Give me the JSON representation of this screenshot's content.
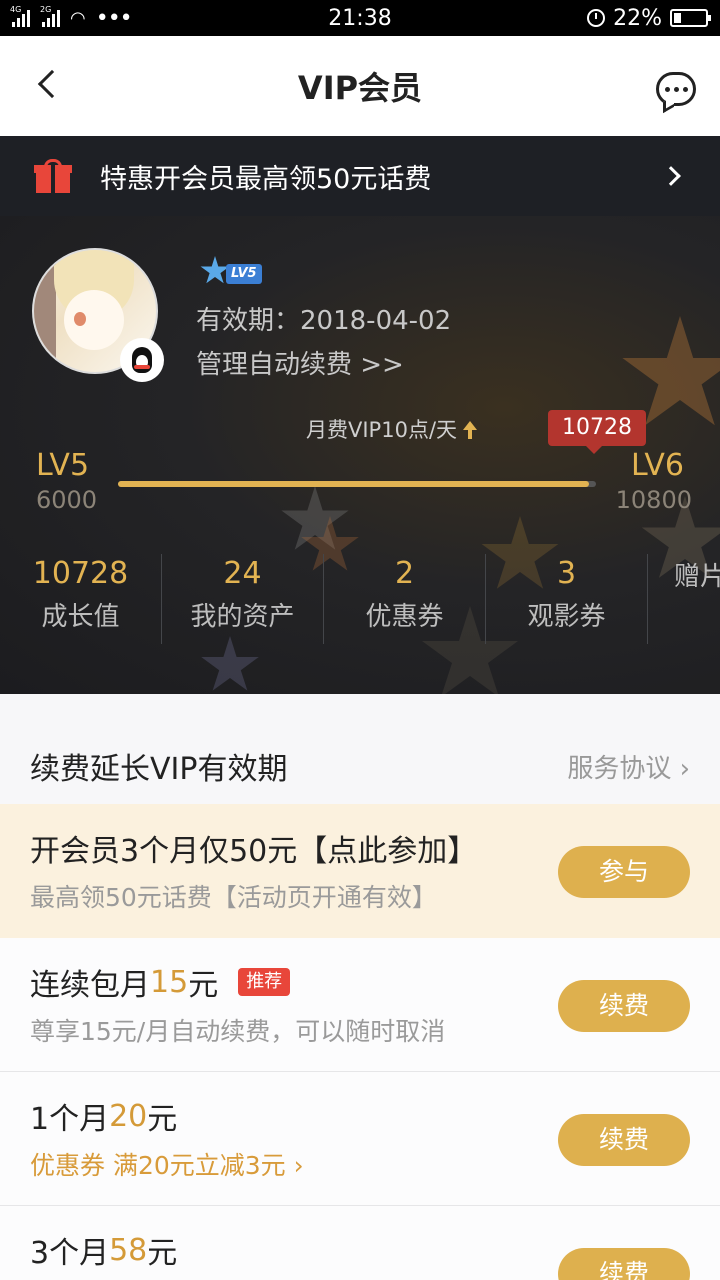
{
  "status_bar": {
    "net_1": "4G",
    "net_2": "2G",
    "time": "21:38",
    "battery": "22%"
  },
  "header": {
    "title": "VIP会员"
  },
  "promo": {
    "text": "特惠开会员最高领50元话费"
  },
  "profile": {
    "level_badge": "LV5",
    "valid_label": "有效期：",
    "valid_date": "2018-04-02",
    "manage_link": "管理自动续费 >>"
  },
  "growth": {
    "rate_text": "月费VIP10点/天",
    "current": "10728",
    "current_value": 10728,
    "level_from": "LV5",
    "level_from_points": "6000",
    "level_to": "LV6",
    "level_to_points": "10800"
  },
  "stats": [
    {
      "value": "10728",
      "label": "成长值"
    },
    {
      "value": "24",
      "label": "我的资产"
    },
    {
      "value": "2",
      "label": "优惠券"
    },
    {
      "value": "3",
      "label": "观影券"
    },
    {
      "value": "",
      "label": "赠片"
    }
  ],
  "renew": {
    "title": "续费延长VIP有效期",
    "service_link": "服务协议",
    "plans": [
      {
        "title": "开会员3个月仅50元【点此参加】",
        "subtitle": "最高领50元话费【活动页开通有效】",
        "button": "参与"
      },
      {
        "title_prefix": "连续包月",
        "price": "15",
        "unit": "元",
        "tag": "推荐",
        "subtitle": "尊享15元/月自动续费，可以随时取消",
        "button": "续费"
      },
      {
        "title_prefix": "1个月",
        "price": "20",
        "unit": "元",
        "subtitle": "优惠券 满20元立减3元",
        "button": "续费"
      },
      {
        "title_prefix": "3个月",
        "price": "58",
        "unit": "元",
        "button": "续费"
      }
    ]
  },
  "colors": {
    "gold": "#e2b352",
    "button": "#deb04e",
    "tag_red": "#e8463a",
    "highlight_bg": "#fbf1de",
    "dark_bg": "#1e2025"
  }
}
